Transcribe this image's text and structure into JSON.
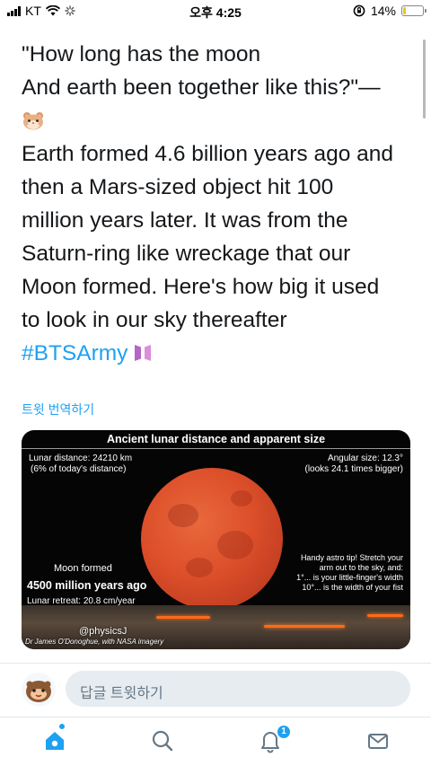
{
  "status_bar": {
    "carrier": "KT",
    "time": "오후 4:25",
    "battery_percent": "14%",
    "battery_level": 0.14
  },
  "tweet": {
    "lines": [
      "\"How long has the moon",
      "And earth been together like this?\"—",
      "Earth formed 4.6 billion years ago and",
      "then a Mars-sized object hit 100",
      "million years later. It was from the",
      "Saturn-ring like wreckage that our",
      "Moon formed. Here's how big it used",
      "to look in our sky thereafter"
    ],
    "hashtag": "#BTSArmy",
    "translate_label": "트윗 번역하기"
  },
  "media": {
    "title": "Ancient lunar distance and apparent size",
    "lunar_distance": "Lunar distance: 24210 km",
    "distance_note": "(6% of today's distance)",
    "angular_size": "Angular size: 12.3°",
    "angular_note": "(looks 24.1 times bigger)",
    "moon_formed": "Moon formed",
    "years_ago": "4500 million years ago",
    "retreat": "Lunar retreat: 20.8 cm/year",
    "tip_1": "Handy astro tip! Stretch your",
    "tip_2": "arm out to the sky, and:",
    "tip_3": "1°... is your little-finger's width",
    "tip_4": "10°... is the width of your fist",
    "handle": "@physicsJ",
    "credit": "Dr James O'Donoghue, with NASA imagery"
  },
  "reply": {
    "placeholder": "답글 트윗하기"
  },
  "tabs": {
    "notification_count": "1"
  },
  "colors": {
    "accent": "#1da1f2",
    "text": "#14171a",
    "moon": "#dc4f2a"
  }
}
